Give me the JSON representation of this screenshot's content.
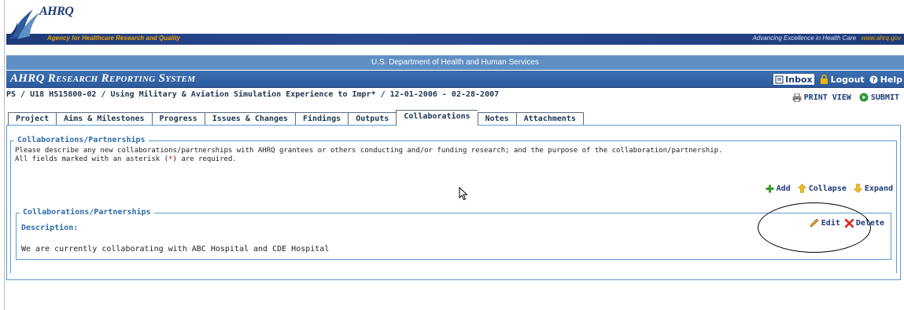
{
  "header": {
    "brand": "AHRQ",
    "agency": "Agency for Healthcare Research and Quality",
    "tagline": "Advancing Excellence in Health Care",
    "tagline_url": "www.ahrq.gov",
    "department": "U.S. Department of Health and Human Services"
  },
  "system": {
    "title": "AHRQ Research Reporting System",
    "inbox_label": "Inbox",
    "logout_label": "Logout",
    "help_label": "Help"
  },
  "breadcrumb": "PS / U18 HS15800-02 / Using Military & Aviation Simulation Experience to Impr* / 12-01-2006 - 02-28-2007",
  "actions": {
    "print_label": "PRINT VIEW",
    "submit_label": "SUBMIT"
  },
  "tabs": [
    {
      "label": "Project"
    },
    {
      "label": "Aims & Milestones"
    },
    {
      "label": "Progress"
    },
    {
      "label": "Issues & Changes"
    },
    {
      "label": "Findings"
    },
    {
      "label": "Outputs"
    },
    {
      "label": "Collaborations",
      "active": true
    },
    {
      "label": "Notes"
    },
    {
      "label": "Attachments"
    }
  ],
  "section": {
    "legend": "Collaborations/Partnerships",
    "intro_line1": "Please describe any new collaborations/partnerships with AHRQ grantees or others conducting and/or funding research; and the purpose of the collaboration/partnership.",
    "intro_line2_pre": "All fields marked with an asterisk (",
    "intro_asterisk": "*",
    "intro_line2_post": ") are required.",
    "add_label": "Add",
    "collapse_label": "Collapse",
    "expand_label": "Expand"
  },
  "entry": {
    "legend": "Collaborations/Partnerships",
    "description_label": "Description:",
    "description_text": "We are currently collaborating with ABC Hospital and CDE Hospital",
    "edit_label": "Edit",
    "delete_label": "Delete"
  },
  "colors": {
    "navy": "#1d3a7a",
    "dept_bar": "#5f8fc4",
    "panel_border": "#5b9bd5",
    "heading_blue": "#2e6ba8",
    "orange": "#f0a400"
  }
}
